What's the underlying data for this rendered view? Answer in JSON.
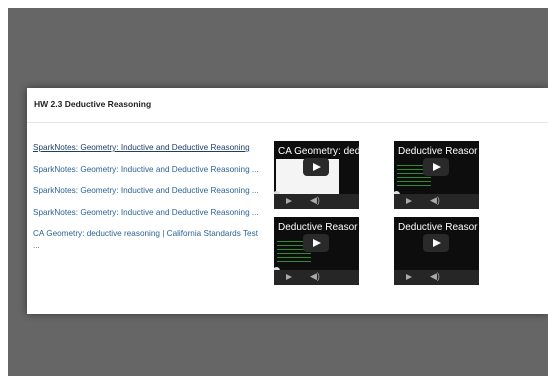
{
  "panel": {
    "title": "HW 2.3 Deductive Reasoning"
  },
  "links": [
    {
      "text": "SparkNotes: Geometry: Inductive and Deductive Reasoning",
      "visited": true
    },
    {
      "text": "SparkNotes: Geometry: Inductive and Deductive Reasoning ...",
      "visited": false
    },
    {
      "text": "SparkNotes: Geometry: Inductive and Deductive Reasoning ...",
      "visited": false
    },
    {
      "text": "SparkNotes: Geometry: Inductive and Deductive Reasoning ...",
      "visited": false
    },
    {
      "text": "CA Geometry: deductive reasoning | California Standards Test ...",
      "visited": false
    }
  ],
  "videos": [
    {
      "title": "CA Geometry: ded"
    },
    {
      "title": "Deductive Reasor"
    },
    {
      "title": "Deductive Reasor"
    },
    {
      "title": "Deductive Reasor"
    }
  ],
  "icons": {
    "play": "play-icon",
    "volume": "volume-icon"
  },
  "colors": {
    "backdrop": "#666666",
    "link": "#2a6496",
    "link_visited": "#1f3d66",
    "video_bg": "#0d0d0d"
  }
}
